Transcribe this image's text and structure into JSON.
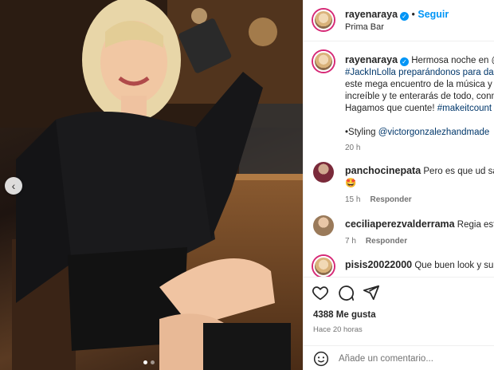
{
  "post": {
    "username": "rayenaraya",
    "follow_label": "Seguir",
    "location": "Prima Bar",
    "verified_mark": "✓"
  },
  "caption": {
    "username": "rayenaraya",
    "line1": "Hermosa noche en @pr",
    "line2": "#JackInLolla preparándonos para darlo",
    "line3": "este mega encuentro de la música y lo",
    "line4": "increíble y te enterarás de todo, conm",
    "line5_text": "Hagamos que cuente! ",
    "line5_tag": "#makeitcount",
    "styling_label": "•Styling ",
    "styling_tag": "@victorgonzalezhandmade",
    "time": "20 h"
  },
  "comments": [
    {
      "username": "panchocinepata",
      "text": "Pero es que ud sale c",
      "text2": "🤩",
      "time": "15 h",
      "reply": "Responder"
    },
    {
      "username": "ceciliaperezvalderrama",
      "text": "Regia estupen",
      "time": "7 h",
      "reply": "Responder"
    },
    {
      "username": "pisis20022000",
      "text": "Que buen look y su nue"
    }
  ],
  "footer": {
    "likes": "4388 Me gusta",
    "timestamp": "Hace 20 horas",
    "comment_placeholder": "Añade un comentario..."
  },
  "carousel": {
    "prev_symbol": "‹",
    "active_slide": 1,
    "total_slides": 2
  },
  "colors": {
    "accent": "#0095f6",
    "link": "#00376b",
    "muted": "#737373"
  },
  "icons": [
    "heart-icon",
    "comment-icon",
    "share-icon",
    "emoji-icon",
    "verified-icon",
    "chevron-left-icon"
  ]
}
